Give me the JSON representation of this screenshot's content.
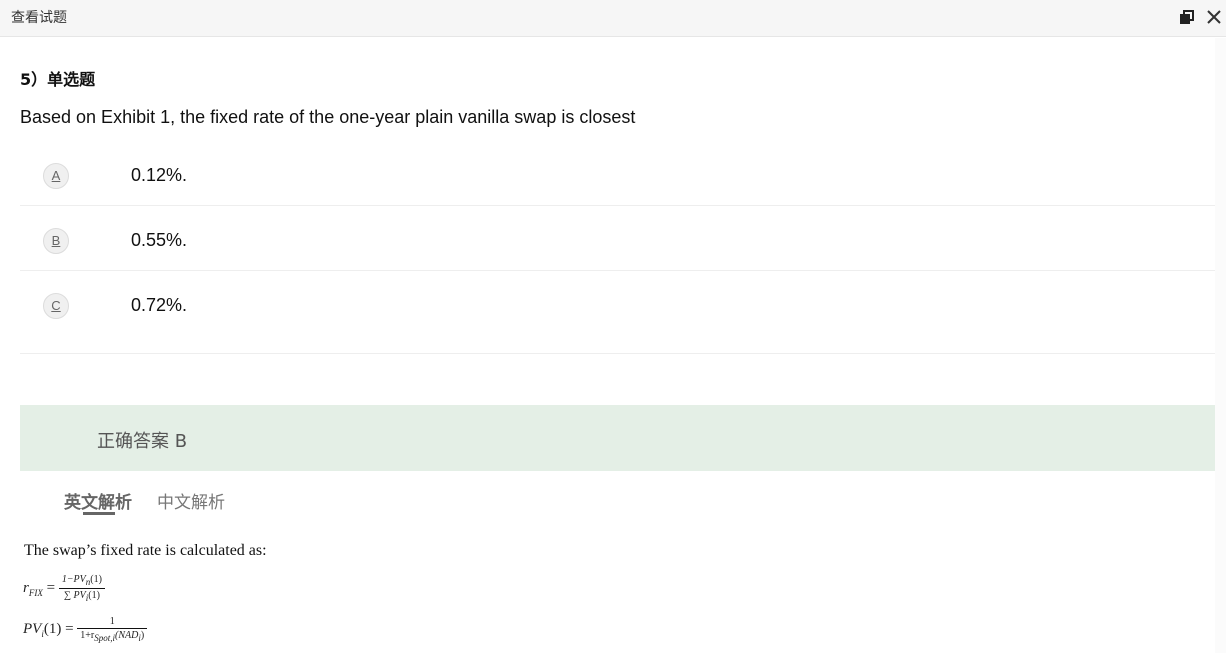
{
  "window": {
    "title": "查看试题",
    "restore_icon": "restore-icon",
    "close_icon": "close-icon"
  },
  "question": {
    "number_label": "5）单选题",
    "stem": "Based on Exhibit 1, the fixed rate of the one-year plain vanilla swap is closest",
    "options": [
      {
        "letter": "A",
        "text": "0.12%."
      },
      {
        "letter": "B",
        "text": "0.55%."
      },
      {
        "letter": "C",
        "text": "0.72%."
      }
    ]
  },
  "answer": {
    "label": "正确答案 B"
  },
  "tabs": {
    "english": "英文解析",
    "chinese": "中文解析"
  },
  "explanation": {
    "intro": "The swap’s fixed rate is calculated as:",
    "formula1_lhs": "r",
    "formula1_sub": "FIX",
    "formula1_num": "1−PV",
    "formula1_num_sub": "n",
    "formula1_num_tail": "(1)",
    "formula1_den": "∑",
    "formula1_den_tail": "PV",
    "formula1_den_sub": "i",
    "formula1_den_end": "(1)",
    "formula2_lhs": "PV",
    "formula2_sub": "i",
    "formula2_lhs_tail": "(1) =",
    "formula2_num": "1",
    "formula2_den": "1+r",
    "formula2_den_sub": "Spot,i",
    "formula2_den_tail": "(NAD",
    "formula2_den_tail_sub": "i",
    "formula2_den_end": ")"
  }
}
